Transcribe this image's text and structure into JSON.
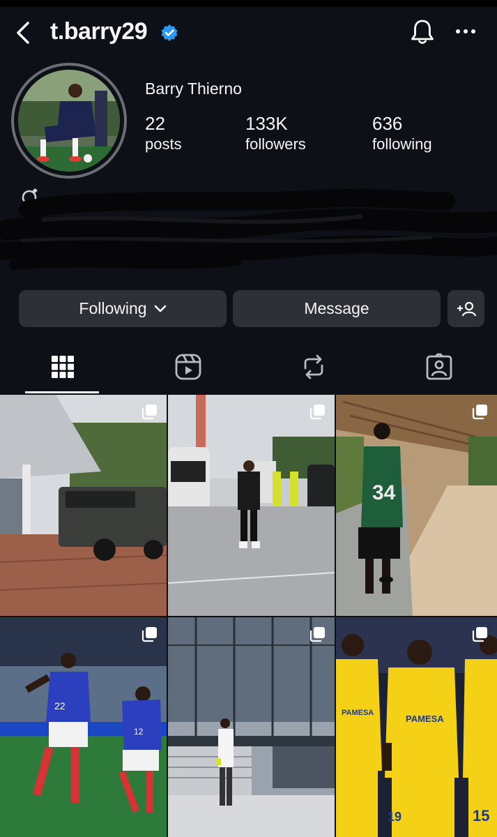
{
  "header": {
    "username": "t.barry29",
    "verified": true,
    "back_icon": "chevron-left-icon",
    "bell_icon": "bell-icon",
    "more_icon": "ellipsis-icon"
  },
  "profile": {
    "display_name": "Barry Thierno",
    "stats": [
      {
        "value": "22",
        "label": "posts"
      },
      {
        "value": "133K",
        "label": "followers"
      },
      {
        "value": "636",
        "label": "following"
      }
    ],
    "bio_icon": "ring-icon"
  },
  "actions": {
    "following_label": "Following",
    "message_label": "Message",
    "add_user_icon": "add-user-icon"
  },
  "tabs": [
    {
      "name": "posts-grid",
      "icon": "grid-icon",
      "active": true
    },
    {
      "name": "reels",
      "icon": "reels-icon",
      "active": false
    },
    {
      "name": "reposts",
      "icon": "repost-icon",
      "active": false
    },
    {
      "name": "tagged",
      "icon": "tagged-person-icon",
      "active": false
    }
  ],
  "posts": [
    {
      "icon": "carousel-icon",
      "scene": "black SUV parked by modern building"
    },
    {
      "icon": "carousel-icon",
      "scene": "player walking on tarmac near bus"
    },
    {
      "icon": "carousel-icon",
      "scene": "player in green 34 jersey on wooden terrace"
    },
    {
      "icon": "carousel-icon",
      "scene": "France players celebrating on pitch"
    },
    {
      "icon": "carousel-icon",
      "scene": "player standing on steps by glass building"
    },
    {
      "icon": "carousel-icon",
      "scene": "Villarreal players celebrating in yellow kits"
    }
  ],
  "colors": {
    "background": "#0d1016",
    "button": "#2e3037",
    "verified_blue": "#2a9af5",
    "villarreal_yellow": "#f4d116",
    "france_blue": "#2c3fbe"
  }
}
